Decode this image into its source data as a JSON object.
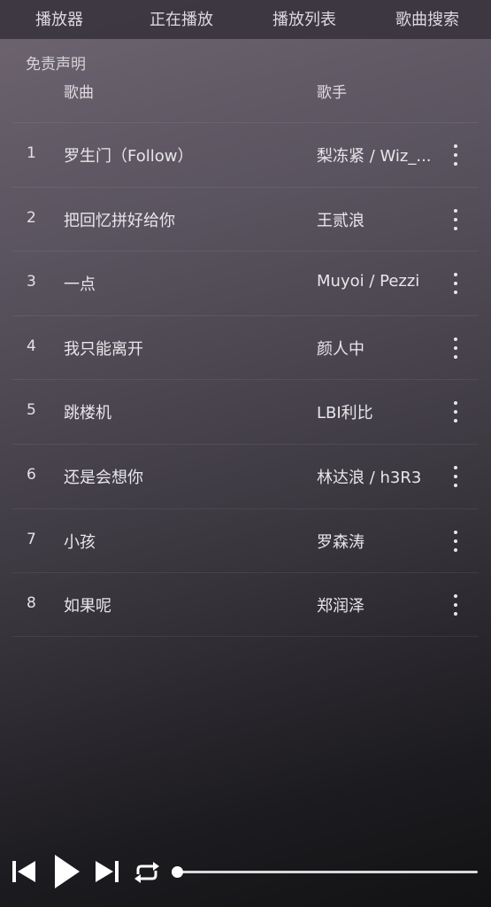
{
  "tabs": [
    {
      "label": "播放器"
    },
    {
      "label": "正在播放"
    },
    {
      "label": "播放列表"
    },
    {
      "label": "歌曲搜索"
    }
  ],
  "disclaimer": "免责声明",
  "header": {
    "song": "歌曲",
    "artist": "歌手"
  },
  "songs": [
    {
      "num": "1",
      "title": "罗生门（Follow）",
      "artist": "梨冻紧 / Wiz_..."
    },
    {
      "num": "2",
      "title": "把回忆拼好给你",
      "artist": "王贰浪"
    },
    {
      "num": "3",
      "title": "一点",
      "artist": "Muyoi / Pezzi"
    },
    {
      "num": "4",
      "title": "我只能离开",
      "artist": "颜人中"
    },
    {
      "num": "5",
      "title": "跳楼机",
      "artist": "LBI利比"
    },
    {
      "num": "6",
      "title": "还是会想你",
      "artist": "林达浪 / h3R3"
    },
    {
      "num": "7",
      "title": "小孩",
      "artist": "罗森涛"
    },
    {
      "num": "8",
      "title": "如果呢",
      "artist": "郑润泽"
    }
  ],
  "player": {
    "icons": [
      "skip-previous-icon",
      "play-icon",
      "skip-next-icon",
      "repeat-icon"
    ],
    "progress": 0.0
  },
  "colors": {
    "topbar": "#3a343e",
    "text": "#e8e6ea"
  }
}
